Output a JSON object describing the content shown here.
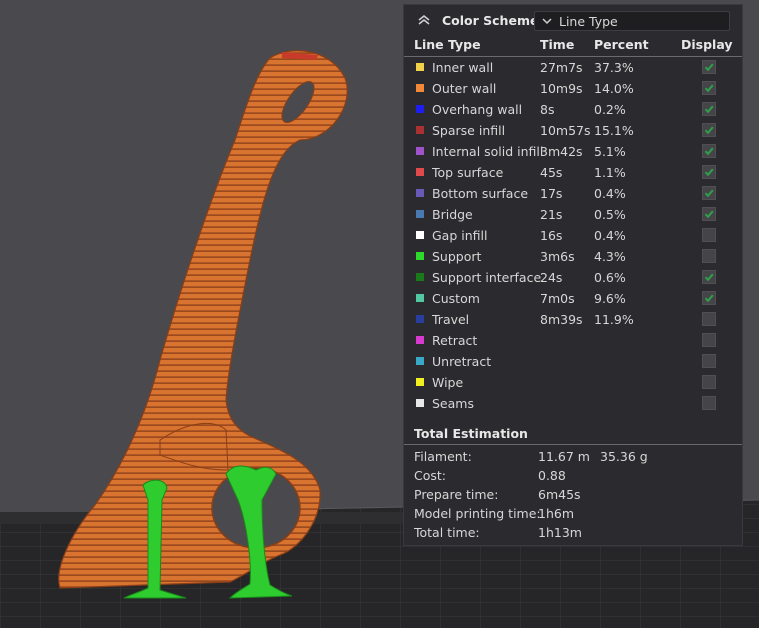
{
  "panel": {
    "header_title": "Color Scheme",
    "scheme_selected": "Line Type",
    "columns": {
      "line_type": "Line Type",
      "time": "Time",
      "percent": "Percent",
      "display": "Display"
    },
    "rows": [
      {
        "name": "Inner wall",
        "time": "27m7s",
        "percent": "37.3%",
        "color": "#f2d24a",
        "checked": true
      },
      {
        "name": "Outer wall",
        "time": "10m9s",
        "percent": "14.0%",
        "color": "#f08a3a",
        "checked": true
      },
      {
        "name": "Overhang wall",
        "time": "8s",
        "percent": "0.2%",
        "color": "#1e1ef0",
        "checked": true
      },
      {
        "name": "Sparse infill",
        "time": "10m57s",
        "percent": "15.1%",
        "color": "#a83232",
        "checked": true
      },
      {
        "name": "Internal solid infill",
        "time": "3m42s",
        "percent": "5.1%",
        "color": "#a052c8",
        "checked": true
      },
      {
        "name": "Top surface",
        "time": "45s",
        "percent": "1.1%",
        "color": "#e04a4a",
        "checked": true
      },
      {
        "name": "Bottom surface",
        "time": "17s",
        "percent": "0.4%",
        "color": "#6a5ab8",
        "checked": true
      },
      {
        "name": "Bridge",
        "time": "21s",
        "percent": "0.5%",
        "color": "#4a78b0",
        "checked": true
      },
      {
        "name": "Gap infill",
        "time": "16s",
        "percent": "0.4%",
        "color": "#ffffff",
        "checked": false
      },
      {
        "name": "Support",
        "time": "3m6s",
        "percent": "4.3%",
        "color": "#2ed82e",
        "checked": false
      },
      {
        "name": "Support interface",
        "time": "24s",
        "percent": "0.6%",
        "color": "#1a7a1a",
        "checked": true
      },
      {
        "name": "Custom",
        "time": "7m0s",
        "percent": "9.6%",
        "color": "#52c8a0",
        "checked": true
      },
      {
        "name": "Travel",
        "time": "8m39s",
        "percent": "11.9%",
        "color": "#2a3ea0",
        "checked": false
      },
      {
        "name": "Retract",
        "time": "",
        "percent": "",
        "color": "#d83ad0",
        "checked": false
      },
      {
        "name": "Unretract",
        "time": "",
        "percent": "",
        "color": "#3aa8c8",
        "checked": false
      },
      {
        "name": "Wipe",
        "time": "",
        "percent": "",
        "color": "#f0f020",
        "checked": false
      },
      {
        "name": "Seams",
        "time": "",
        "percent": "",
        "color": "#e8e8e8",
        "checked": false
      }
    ],
    "estimation": {
      "title": "Total Estimation",
      "filament_label": "Filament:",
      "filament_length": "11.67 m",
      "filament_weight": "35.36 g",
      "cost_label": "Cost:",
      "cost_value": "0.88",
      "prepare_label": "Prepare time:",
      "prepare_value": "6m45s",
      "model_label": "Model printing time:",
      "model_value": "1h6m",
      "total_label": "Total time:",
      "total_value": "1h13m"
    }
  },
  "colors": {
    "model_orange": "#d97330",
    "model_layer_dark": "#9a4a1e",
    "support_green": "#2ecc2e",
    "check_green": "#2ea04a",
    "bed": "#2a2a2c"
  }
}
